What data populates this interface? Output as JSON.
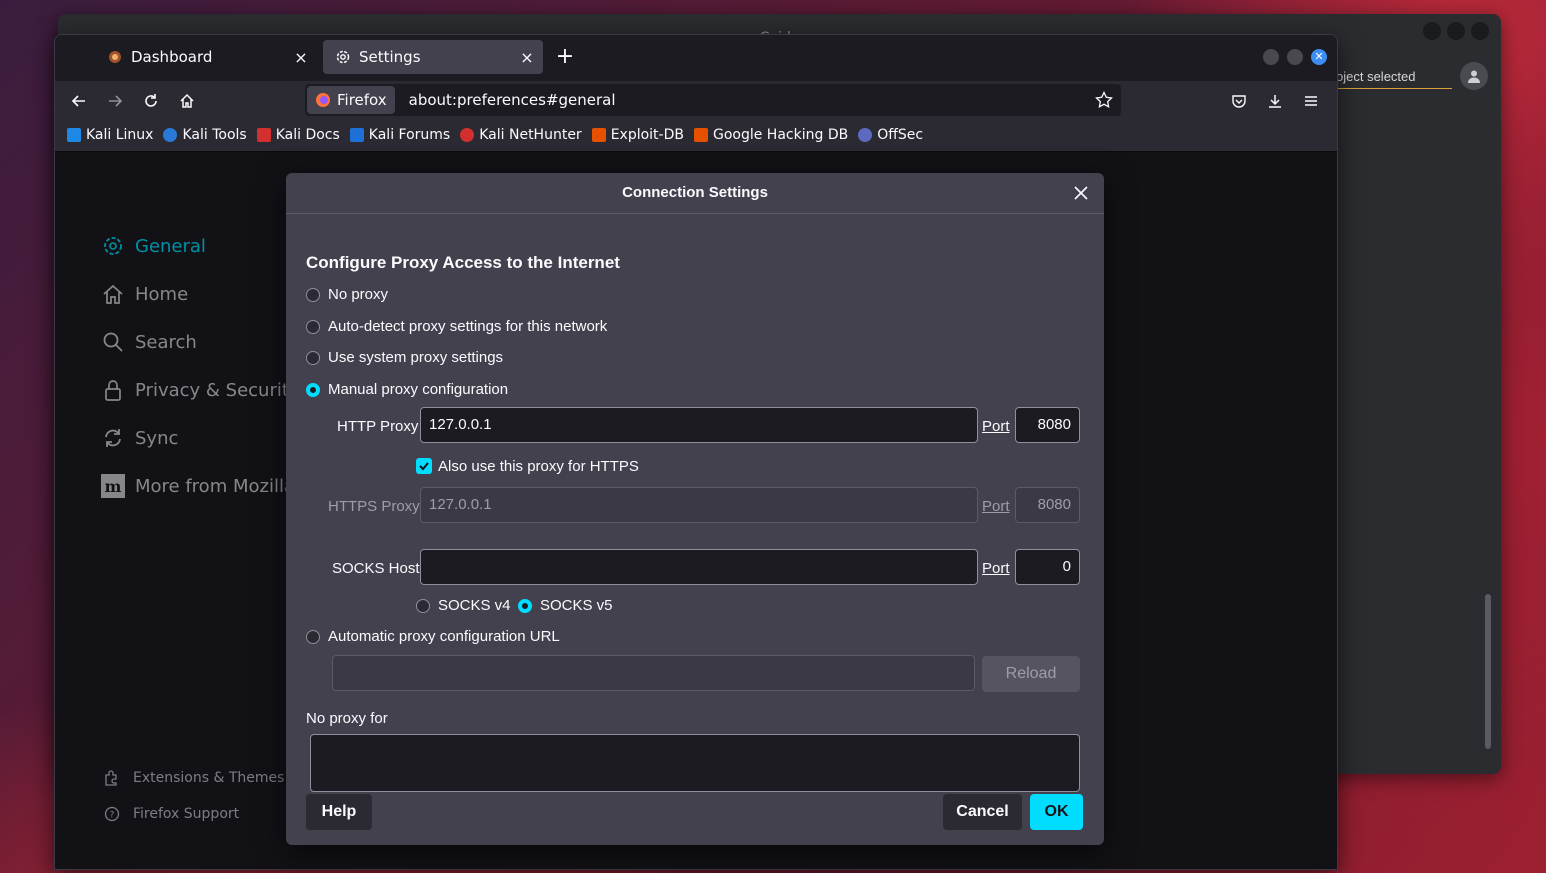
{
  "caido": {
    "title": "Caido",
    "project_selector": "oject selected"
  },
  "browser": {
    "tabs": [
      {
        "label": "Dashboard",
        "close": "×"
      },
      {
        "label": "Settings",
        "close": "×"
      }
    ],
    "new_tab": "+",
    "identity_label": "Firefox",
    "url": "about:preferences#general",
    "bookmarks": [
      {
        "label": "Kali Linux",
        "color": "#1e88e5"
      },
      {
        "label": "Kali Tools",
        "color": "#2a79d9"
      },
      {
        "label": "Kali Docs",
        "color": "#d32f2f"
      },
      {
        "label": "Kali Forums",
        "color": "#1e6fd6"
      },
      {
        "label": "Kali NetHunter",
        "color": "#d32f2f"
      },
      {
        "label": "Exploit-DB",
        "color": "#e65100"
      },
      {
        "label": "Google Hacking DB",
        "color": "#e65100"
      },
      {
        "label": "OffSec",
        "color": "#5c6bc0"
      }
    ]
  },
  "sidebar": {
    "items": [
      {
        "label": "General",
        "icon": "gear-icon"
      },
      {
        "label": "Home",
        "icon": "home-icon"
      },
      {
        "label": "Search",
        "icon": "search-icon"
      },
      {
        "label": "Privacy & Security",
        "icon": "lock-icon"
      },
      {
        "label": "Sync",
        "icon": "sync-icon"
      },
      {
        "label": "More from Mozilla",
        "icon": "mozilla-icon"
      }
    ],
    "footer": [
      {
        "label": "Extensions & Themes",
        "icon": "puzzle-icon"
      },
      {
        "label": "Firefox Support",
        "icon": "help-icon"
      }
    ]
  },
  "dialog": {
    "title": "Connection Settings",
    "heading": "Configure Proxy Access to the Internet",
    "options": {
      "no_proxy": "No proxy",
      "auto_detect": "Auto-detect proxy settings for this network",
      "system": "Use system proxy settings",
      "manual": "Manual proxy configuration",
      "auto_url": "Automatic proxy configuration URL"
    },
    "selected_option": "manual",
    "http_proxy_label": "HTTP Proxy",
    "http_proxy_value": "127.0.0.1",
    "port_label": "Port",
    "http_port": "8080",
    "also_https_label": "Also use this proxy for HTTPS",
    "also_https_checked": true,
    "https_proxy_label": "HTTPS Proxy",
    "https_proxy_value": "127.0.0.1",
    "https_port": "8080",
    "socks_host_label": "SOCKS Host",
    "socks_host_value": "",
    "socks_port": "0",
    "socks_v4": "SOCKS v4",
    "socks_v5": "SOCKS v5",
    "socks_version": "v5",
    "auto_url_value": "",
    "reload_label": "Reload",
    "no_proxy_for_label": "No proxy for",
    "no_proxy_for_value": "",
    "help_label": "Help",
    "cancel_label": "Cancel",
    "ok_label": "OK",
    "accent_color": "#00ddff"
  }
}
